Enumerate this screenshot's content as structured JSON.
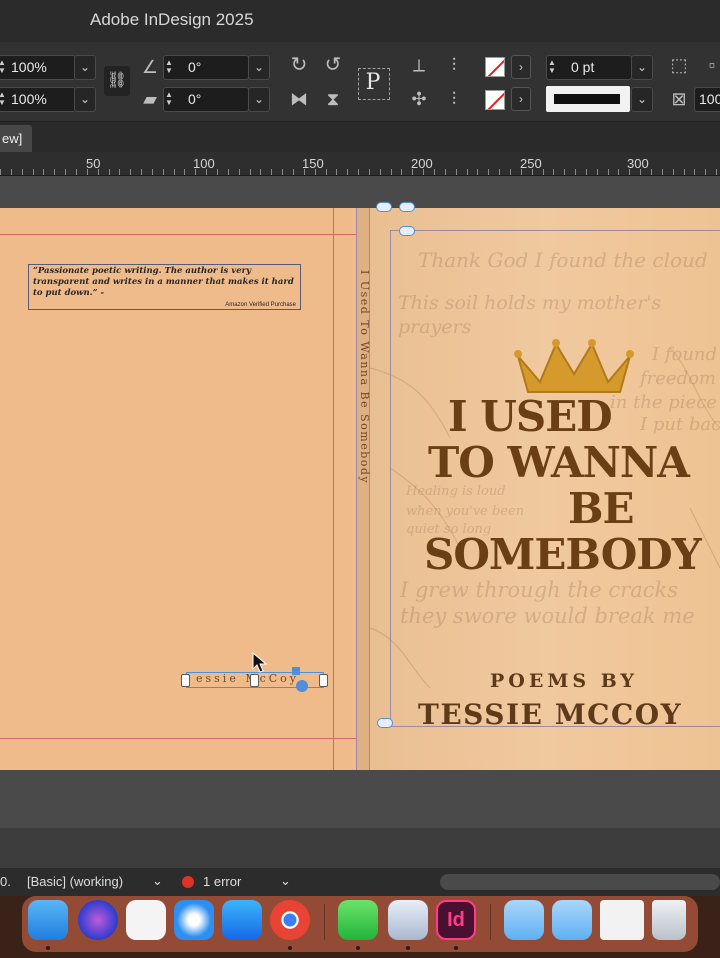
{
  "app": {
    "title": "Adobe InDesign 2025"
  },
  "control_panel": {
    "scale_x": "100%",
    "scale_y": "100%",
    "rotate_angle": "0°",
    "shear_angle": "0°",
    "stroke_weight": "0 pt",
    "partial_value": "100",
    "type_tool_glyph": "P"
  },
  "tab": {
    "label": "ew]"
  },
  "ruler": {
    "ticks": [
      "50",
      "100",
      "150",
      "200",
      "250",
      "300"
    ]
  },
  "back_cover": {
    "quote": "“Passionate poetic writing. The author is very transparent and writes in a manner that makes it hard to put down.” -",
    "quote_source": "Amazon Verified Purchase",
    "author_text": "essie McCoy"
  },
  "spine": {
    "text": "I Used To Wanna Be Somebody"
  },
  "front_cover": {
    "title_line1": "I USED",
    "title_line2": "TO WANNA",
    "title_line3": "BE",
    "title_line4": "SOMEBODY",
    "subtitle": "POEMS BY",
    "author": "TESSIE MCCOY",
    "bg_script": [
      "Thank God I found the cloud",
      "This soil holds my mother's",
      "prayers",
      "I found",
      "freedom in",
      "in the piece",
      "I put back",
      "Healing is loud",
      "when you've been",
      "quiet so long",
      "I grew through the cracks",
      "they swore would break me"
    ]
  },
  "status_bar": {
    "page_indicator": "0.",
    "profile": "[Basic] (working)",
    "errors": "1 error"
  },
  "colors": {
    "cover_bg": "#efbb8a",
    "title_brown": "#6a3f16",
    "crown_gold": "#d69a2c",
    "error_red": "#e0312b"
  }
}
